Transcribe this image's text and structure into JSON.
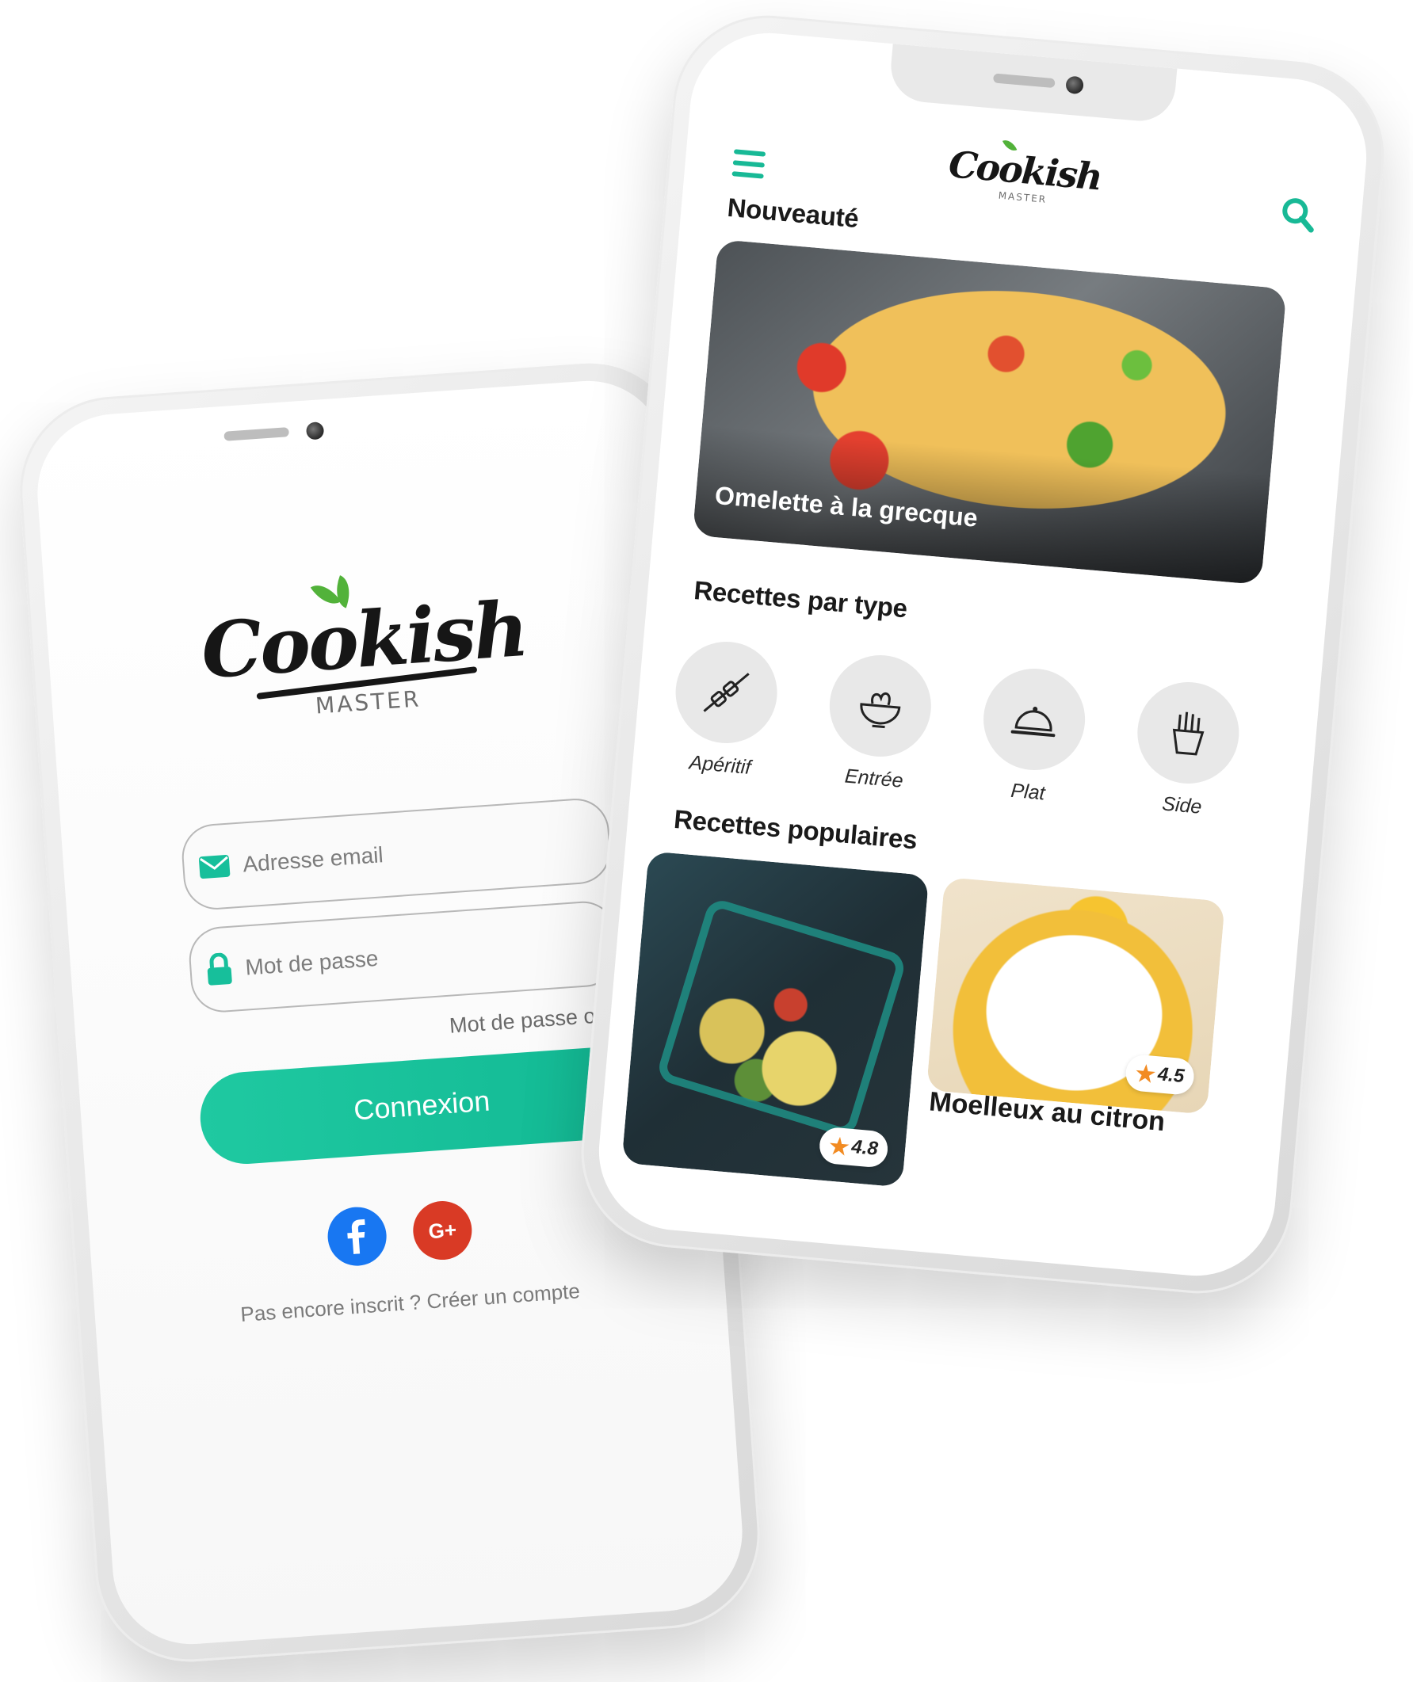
{
  "login": {
    "logo_text": "Cookish",
    "logo_subtext": "MASTER",
    "email_placeholder": "Adresse email",
    "password_placeholder": "Mot de passe",
    "forgot_password": "Mot de passe oublié ?",
    "login_button": "Connexion",
    "social": [
      "facebook-icon",
      "google-plus-icon"
    ],
    "signup_text": "Pas encore inscrit ? Créer un compte",
    "colors": {
      "accent": "#17bf9b",
      "facebook": "#1877f2",
      "google": "#d93a25"
    }
  },
  "home": {
    "logo_text": "Cookish",
    "logo_subtext": "MASTER",
    "icons": {
      "menu": "menu-icon",
      "search": "search-icon"
    },
    "new_title": "Nouveauté",
    "featured_recipe": "Omelette à la grecque",
    "types_title": "Recettes par type",
    "types": [
      {
        "label": "Apéritif",
        "icon": "skewer-icon"
      },
      {
        "label": "Entrée",
        "icon": "salad-bowl-icon"
      },
      {
        "label": "Plat",
        "icon": "cloche-icon"
      },
      {
        "label": "Side",
        "icon": "fries-icon"
      }
    ],
    "popular_title": "Recettes populaires",
    "popular": [
      {
        "title": "",
        "rating": "4.8"
      },
      {
        "title": "Moelleux au citron",
        "rating": "4.5"
      }
    ],
    "colors": {
      "accent": "#18b996"
    }
  }
}
